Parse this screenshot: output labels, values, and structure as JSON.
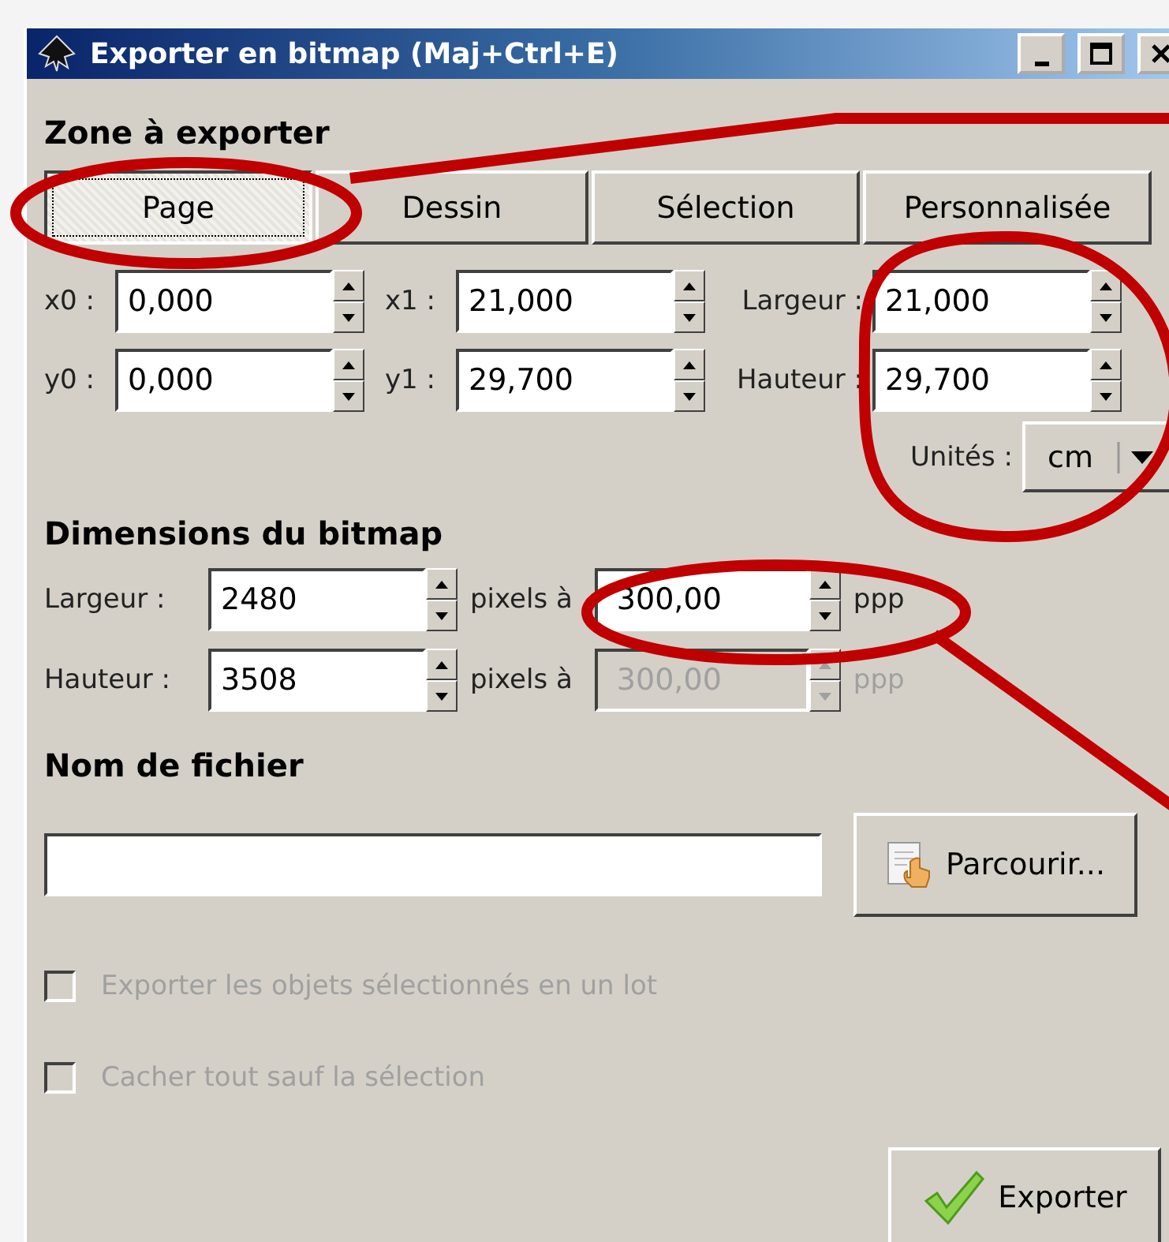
{
  "window": {
    "title": "Exporter en bitmap (Maj+Ctrl+E)"
  },
  "export_area": {
    "heading": "Zone à exporter",
    "tabs": [
      {
        "label": "Page",
        "selected": true
      },
      {
        "label": "Dessin",
        "selected": false
      },
      {
        "label": "Sélection",
        "selected": false
      },
      {
        "label": "Personnalisée",
        "selected": false
      }
    ],
    "fields": [
      {
        "label": "x0 :",
        "value": "0,000"
      },
      {
        "label": "x1 :",
        "value": "21,000"
      },
      {
        "label": "Largeur :",
        "value": "21,000"
      },
      {
        "label": "y0 :",
        "value": "0,000"
      },
      {
        "label": "y1 :",
        "value": "29,700"
      },
      {
        "label": "Hauteur :",
        "value": "29,700"
      }
    ],
    "units": {
      "label": "Unités :",
      "value": "cm"
    }
  },
  "bitmap_size": {
    "heading": "Dimensions du bitmap",
    "rows": [
      {
        "label": "Largeur :",
        "value": "2480",
        "between": "pixels à",
        "dpi": "300,00",
        "unit": "ppp",
        "disabled": false
      },
      {
        "label": "Hauteur :",
        "value": "3508",
        "between": "pixels à",
        "dpi": "300,00",
        "unit": "ppp",
        "disabled": true
      }
    ]
  },
  "filename": {
    "heading": "Nom de fichier",
    "browse_button": "Parcourir..."
  },
  "options": [
    {
      "label": "Exporter les objets sélectionnés en un lot",
      "checked": false,
      "disabled": true
    },
    {
      "label": "Cacher tout sauf la sélection",
      "checked": false,
      "disabled": true
    }
  ],
  "export_button": "Exporter",
  "annotations": [
    {
      "kind": "ellipse"
    },
    {
      "kind": "line"
    },
    {
      "kind": "ellipse"
    },
    {
      "kind": "ellipse"
    },
    {
      "kind": "line"
    }
  ]
}
